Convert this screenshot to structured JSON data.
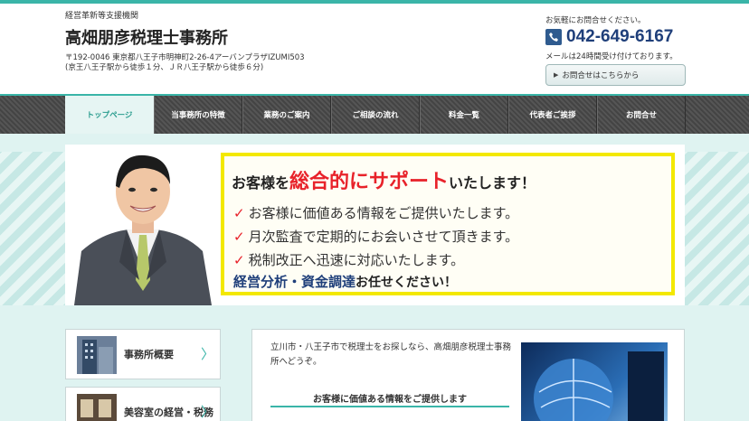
{
  "header": {
    "tagline": "経営革新等支援機関",
    "title": "高畑朋彦税理士事務所",
    "address_line1": "〒192-0046 東京都八王子市明神町2-26-4アーバンプラザIZUMI503",
    "address_line2": "(京王八王子駅から徒歩１分、ＪＲ八王子駅から徒歩６分)",
    "contact_lead": "お気軽にお問合せください。",
    "phone": "042-649-6167",
    "hours": "メールは24時間受け付けております。",
    "inquiry_button": "お問合せはこちらから"
  },
  "nav": {
    "items": [
      {
        "label": "トップページ"
      },
      {
        "label": "当事務所の特徴"
      },
      {
        "label": "業務のご案内"
      },
      {
        "label": "ご相談の流れ"
      },
      {
        "label": "料金一覧"
      },
      {
        "label": "代表者ご挨拶"
      },
      {
        "label": "お問合せ"
      }
    ]
  },
  "banner": {
    "head_pre": "お客様を",
    "head_red": "総合的にサポート",
    "head_post": "いたします！",
    "lines": [
      "お客様に価値ある情報をご提供いたします。",
      "月次監査で定期的にお会いさせて頂きます。",
      "税制改正へ迅速に対応いたします。"
    ],
    "foot_blue": "経営分析・資金調達",
    "foot_black": "お任せください！"
  },
  "sidebar": {
    "cards": [
      {
        "label": "事務所概要"
      },
      {
        "label": "美容室の経営・税務"
      }
    ]
  },
  "intro": {
    "text": "立川市・八王子市で税理士をお探しなら、高畑朋彦税理士事務所へどうぞ。",
    "subheading": "お客様に価値ある情報をご提供します"
  },
  "colors": {
    "accent": "#3ab5a8",
    "phone_blue": "#1f3f7a",
    "banner_red": "#e8222a",
    "banner_yellow": "#f3e800"
  }
}
